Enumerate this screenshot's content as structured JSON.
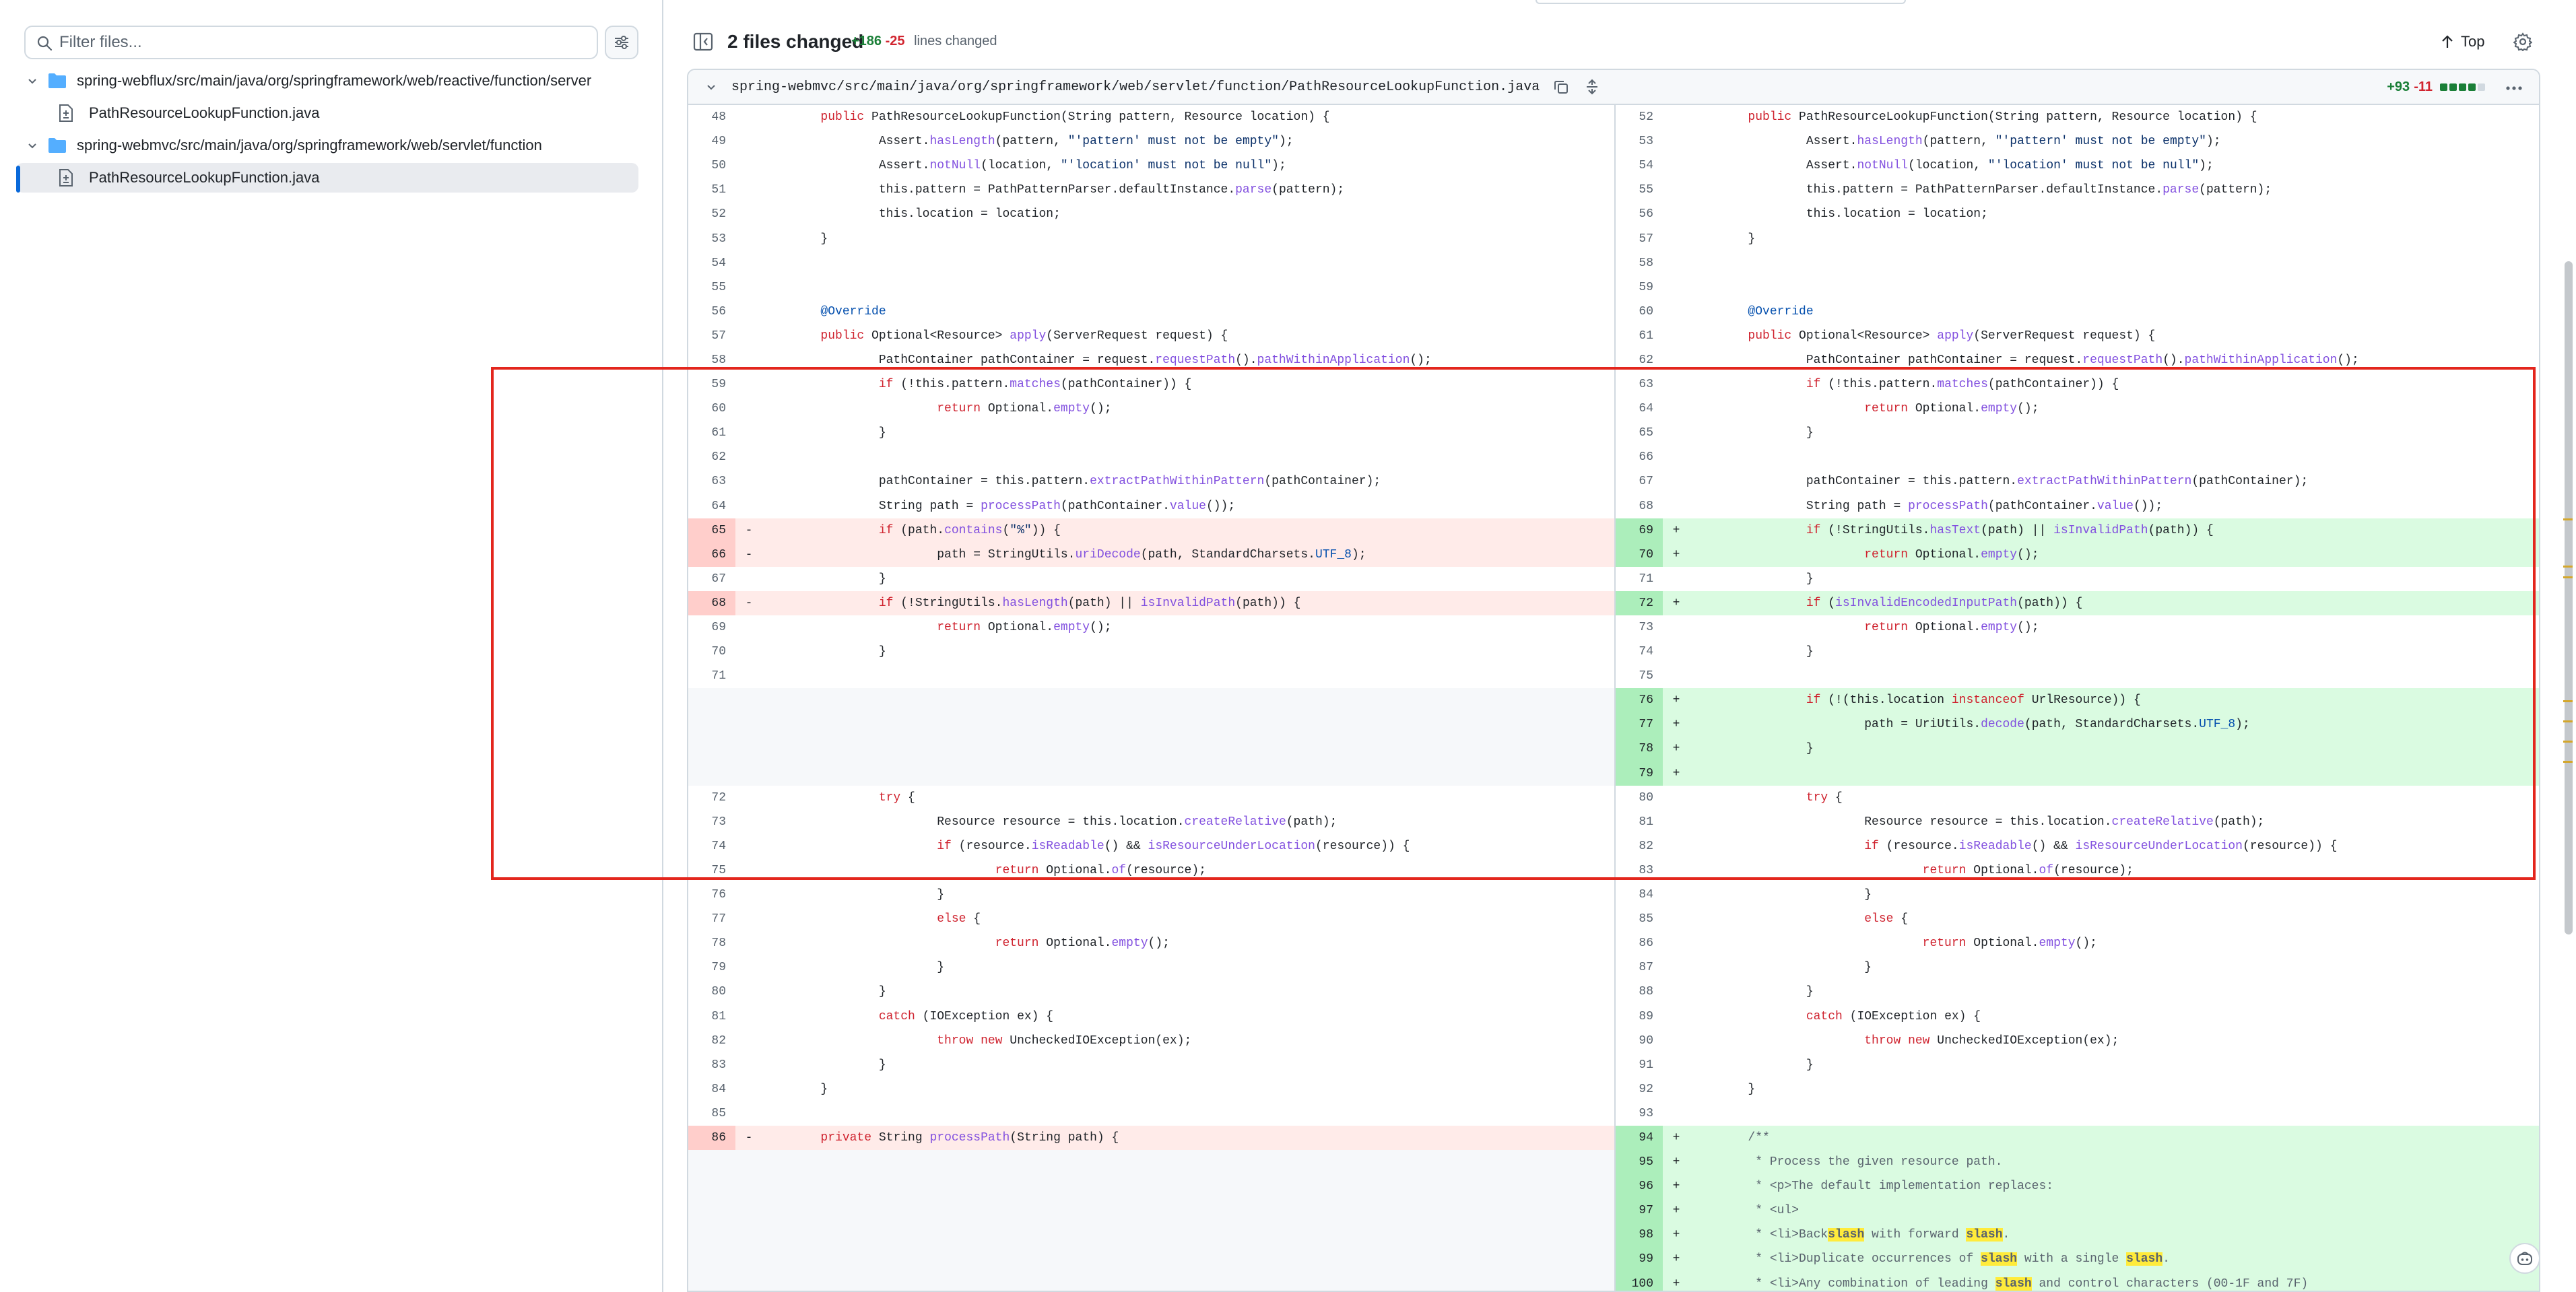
{
  "sidebar": {
    "filter_placeholder": "Filter files...",
    "tree": [
      {
        "type": "folder",
        "label": "spring-webflux/src/main/java/org/springframework/web/reactive/function/server"
      },
      {
        "type": "file",
        "label": "PathResourceLookupFunction.java"
      },
      {
        "type": "folder",
        "label": "spring-webmvc/src/main/java/org/springframework/web/servlet/function"
      },
      {
        "type": "file",
        "label": "PathResourceLookupFunction.java",
        "selected": true
      }
    ]
  },
  "header": {
    "files_changed": "2 files changed",
    "additions": "+186",
    "deletions": "-25",
    "lines_label": "lines changed",
    "top_label": "Top"
  },
  "file": {
    "path": "spring-webmvc/src/main/java/org/springframework/web/servlet/function/PathResourceLookupFunction.java",
    "additions": "+93",
    "deletions": "-11"
  },
  "colors": {
    "add_line": "#dafbe1",
    "add_gutter": "#aceebb",
    "del_line": "#ffebe9",
    "del_gutter": "#ffcecb",
    "annotation": "#e3261d"
  },
  "diff": {
    "left": [
      {
        "ln": "48",
        "t": "ctx",
        "c": "        public PathResourceLookupFunction(String pattern, Resource location) {"
      },
      {
        "ln": "49",
        "t": "ctx",
        "c": "                Assert.hasLength(pattern, \"'pattern' must not be empty\");"
      },
      {
        "ln": "50",
        "t": "ctx",
        "c": "                Assert.notNull(location, \"'location' must not be null\");"
      },
      {
        "ln": "51",
        "t": "ctx",
        "c": "                this.pattern = PathPatternParser.defaultInstance.parse(pattern);"
      },
      {
        "ln": "52",
        "t": "ctx",
        "c": "                this.location = location;"
      },
      {
        "ln": "53",
        "t": "ctx",
        "c": "        }"
      },
      {
        "ln": "54",
        "t": "ctx",
        "c": ""
      },
      {
        "ln": "55",
        "t": "ctx",
        "c": ""
      },
      {
        "ln": "56",
        "t": "ctx",
        "c": "        @Override"
      },
      {
        "ln": "57",
        "t": "ctx",
        "c": "        public Optional<Resource> apply(ServerRequest request) {"
      },
      {
        "ln": "58",
        "t": "ctx",
        "c": "                PathContainer pathContainer = request.requestPath().pathWithinApplication();"
      },
      {
        "ln": "59",
        "t": "ctx",
        "c": "                if (!this.pattern.matches(pathContainer)) {"
      },
      {
        "ln": "60",
        "t": "ctx",
        "c": "                        return Optional.empty();"
      },
      {
        "ln": "61",
        "t": "ctx",
        "c": "                }"
      },
      {
        "ln": "62",
        "t": "ctx",
        "c": ""
      },
      {
        "ln": "63",
        "t": "ctx",
        "c": "                pathContainer = this.pattern.extractPathWithinPattern(pathContainer);"
      },
      {
        "ln": "64",
        "t": "ctx",
        "c": "                String path = processPath(pathContainer.value());"
      },
      {
        "ln": "65",
        "t": "del",
        "c": "                if (path.contains(\"%\")) {"
      },
      {
        "ln": "66",
        "t": "del",
        "c": "                        path = StringUtils.uriDecode(path, StandardCharsets.UTF_8);"
      },
      {
        "ln": "67",
        "t": "ctx",
        "c": "                }"
      },
      {
        "ln": "68",
        "t": "del",
        "c": "                if (!StringUtils.hasLength(path) || isInvalidPath(path)) {"
      },
      {
        "ln": "69",
        "t": "ctx",
        "c": "                        return Optional.empty();"
      },
      {
        "ln": "70",
        "t": "ctx",
        "c": "                }"
      },
      {
        "ln": "71",
        "t": "ctx",
        "c": ""
      },
      {
        "ln": "",
        "t": "empty",
        "c": ""
      },
      {
        "ln": "",
        "t": "empty",
        "c": ""
      },
      {
        "ln": "",
        "t": "empty",
        "c": ""
      },
      {
        "ln": "",
        "t": "empty",
        "c": ""
      },
      {
        "ln": "72",
        "t": "ctx",
        "c": "                try {"
      },
      {
        "ln": "73",
        "t": "ctx",
        "c": "                        Resource resource = this.location.createRelative(path);"
      },
      {
        "ln": "74",
        "t": "ctx",
        "c": "                        if (resource.isReadable() && isResourceUnderLocation(resource)) {"
      },
      {
        "ln": "75",
        "t": "ctx",
        "c": "                                return Optional.of(resource);"
      },
      {
        "ln": "76",
        "t": "ctx",
        "c": "                        }"
      },
      {
        "ln": "77",
        "t": "ctx",
        "c": "                        else {"
      },
      {
        "ln": "78",
        "t": "ctx",
        "c": "                                return Optional.empty();"
      },
      {
        "ln": "79",
        "t": "ctx",
        "c": "                        }"
      },
      {
        "ln": "80",
        "t": "ctx",
        "c": "                }"
      },
      {
        "ln": "81",
        "t": "ctx",
        "c": "                catch (IOException ex) {"
      },
      {
        "ln": "82",
        "t": "ctx",
        "c": "                        throw new UncheckedIOException(ex);"
      },
      {
        "ln": "83",
        "t": "ctx",
        "c": "                }"
      },
      {
        "ln": "84",
        "t": "ctx",
        "c": "        }"
      },
      {
        "ln": "85",
        "t": "ctx",
        "c": ""
      },
      {
        "ln": "86",
        "t": "del",
        "c": "        private String processPath(String path) {"
      },
      {
        "ln": "",
        "t": "empty",
        "c": ""
      },
      {
        "ln": "",
        "t": "empty",
        "c": ""
      },
      {
        "ln": "",
        "t": "empty",
        "c": ""
      },
      {
        "ln": "",
        "t": "empty",
        "c": ""
      },
      {
        "ln": "",
        "t": "empty",
        "c": ""
      },
      {
        "ln": "",
        "t": "empty",
        "c": ""
      },
      {
        "ln": "",
        "t": "empty",
        "c": ""
      }
    ],
    "right": [
      {
        "ln": "52",
        "t": "ctx",
        "c": "        public PathResourceLookupFunction(String pattern, Resource location) {"
      },
      {
        "ln": "53",
        "t": "ctx",
        "c": "                Assert.hasLength(pattern, \"'pattern' must not be empty\");"
      },
      {
        "ln": "54",
        "t": "ctx",
        "c": "                Assert.notNull(location, \"'location' must not be null\");"
      },
      {
        "ln": "55",
        "t": "ctx",
        "c": "                this.pattern = PathPatternParser.defaultInstance.parse(pattern);"
      },
      {
        "ln": "56",
        "t": "ctx",
        "c": "                this.location = location;"
      },
      {
        "ln": "57",
        "t": "ctx",
        "c": "        }"
      },
      {
        "ln": "58",
        "t": "ctx",
        "c": ""
      },
      {
        "ln": "59",
        "t": "ctx",
        "c": ""
      },
      {
        "ln": "60",
        "t": "ctx",
        "c": "        @Override"
      },
      {
        "ln": "61",
        "t": "ctx",
        "c": "        public Optional<Resource> apply(ServerRequest request) {"
      },
      {
        "ln": "62",
        "t": "ctx",
        "c": "                PathContainer pathContainer = request.requestPath().pathWithinApplication();"
      },
      {
        "ln": "63",
        "t": "ctx",
        "c": "                if (!this.pattern.matches(pathContainer)) {"
      },
      {
        "ln": "64",
        "t": "ctx",
        "c": "                        return Optional.empty();"
      },
      {
        "ln": "65",
        "t": "ctx",
        "c": "                }"
      },
      {
        "ln": "66",
        "t": "ctx",
        "c": ""
      },
      {
        "ln": "67",
        "t": "ctx",
        "c": "                pathContainer = this.pattern.extractPathWithinPattern(pathContainer);"
      },
      {
        "ln": "68",
        "t": "ctx",
        "c": "                String path = processPath(pathContainer.value());"
      },
      {
        "ln": "69",
        "t": "add",
        "c": "                if (!StringUtils.hasText(path) || isInvalidPath(path)) {"
      },
      {
        "ln": "70",
        "t": "add",
        "c": "                        return Optional.empty();"
      },
      {
        "ln": "71",
        "t": "ctx",
        "c": "                }"
      },
      {
        "ln": "72",
        "t": "add",
        "c": "                if (isInvalidEncodedInputPath(path)) {"
      },
      {
        "ln": "73",
        "t": "ctx",
        "c": "                        return Optional.empty();"
      },
      {
        "ln": "74",
        "t": "ctx",
        "c": "                }"
      },
      {
        "ln": "75",
        "t": "ctx",
        "c": ""
      },
      {
        "ln": "76",
        "t": "add",
        "c": "                if (!(this.location instanceof UrlResource)) {"
      },
      {
        "ln": "77",
        "t": "add",
        "c": "                        path = UriUtils.decode(path, StandardCharsets.UTF_8);"
      },
      {
        "ln": "78",
        "t": "add",
        "c": "                }"
      },
      {
        "ln": "79",
        "t": "add",
        "c": ""
      },
      {
        "ln": "80",
        "t": "ctx",
        "c": "                try {"
      },
      {
        "ln": "81",
        "t": "ctx",
        "c": "                        Resource resource = this.location.createRelative(path);"
      },
      {
        "ln": "82",
        "t": "ctx",
        "c": "                        if (resource.isReadable() && isResourceUnderLocation(resource)) {"
      },
      {
        "ln": "83",
        "t": "ctx",
        "c": "                                return Optional.of(resource);"
      },
      {
        "ln": "84",
        "t": "ctx",
        "c": "                        }"
      },
      {
        "ln": "85",
        "t": "ctx",
        "c": "                        else {"
      },
      {
        "ln": "86",
        "t": "ctx",
        "c": "                                return Optional.empty();"
      },
      {
        "ln": "87",
        "t": "ctx",
        "c": "                        }"
      },
      {
        "ln": "88",
        "t": "ctx",
        "c": "                }"
      },
      {
        "ln": "89",
        "t": "ctx",
        "c": "                catch (IOException ex) {"
      },
      {
        "ln": "90",
        "t": "ctx",
        "c": "                        throw new UncheckedIOException(ex);"
      },
      {
        "ln": "91",
        "t": "ctx",
        "c": "                }"
      },
      {
        "ln": "92",
        "t": "ctx",
        "c": "        }"
      },
      {
        "ln": "93",
        "t": "ctx",
        "c": ""
      },
      {
        "ln": "94",
        "t": "add",
        "c": "        /**"
      },
      {
        "ln": "95",
        "t": "add",
        "c": "         * Process the given resource path."
      },
      {
        "ln": "96",
        "t": "add",
        "c": "         * <p>The default implementation replaces:"
      },
      {
        "ln": "97",
        "t": "add",
        "c": "         * <ul>"
      },
      {
        "ln": "98",
        "t": "add",
        "c": "         * <li>Backslash with forward slash."
      },
      {
        "ln": "99",
        "t": "add",
        "c": "         * <li>Duplicate occurrences of slash with a single slash."
      },
      {
        "ln": "100",
        "t": "add",
        "c": "         * <li>Any combination of leading slash and control characters (00-1F and 7F)"
      }
    ]
  }
}
